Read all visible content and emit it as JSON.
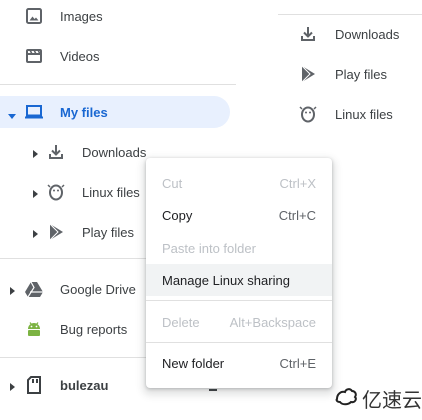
{
  "colors": {
    "accent": "#1967d2",
    "selected_bg": "#e8f0fe",
    "text": "#3c4043",
    "disabled_text": "#bdc1c6",
    "android_green": "#7cb342",
    "drive_grey": "#5f6368"
  },
  "sidebar": {
    "items": [
      {
        "label": "Images",
        "icon": "image-icon"
      },
      {
        "label": "Videos",
        "icon": "video-icon"
      },
      {
        "label": "My files",
        "icon": "laptop-icon",
        "selected": true
      },
      {
        "label": "Downloads",
        "icon": "download-icon"
      },
      {
        "label": "Linux files",
        "icon": "penguin-icon"
      },
      {
        "label": "Play files",
        "icon": "play-icon"
      },
      {
        "label": "Google Drive",
        "icon": "drive-icon"
      },
      {
        "label": "Bug reports",
        "icon": "android-icon"
      },
      {
        "label": "bulezau",
        "icon": "usb-drive-icon"
      }
    ]
  },
  "main": {
    "files": [
      {
        "label": "Downloads",
        "icon": "download-icon"
      },
      {
        "label": "Play files",
        "icon": "play-icon"
      },
      {
        "label": "Linux files",
        "icon": "penguin-icon"
      }
    ]
  },
  "context_menu": {
    "items": [
      {
        "label": "Cut",
        "shortcut": "Ctrl+X",
        "disabled": true
      },
      {
        "label": "Copy",
        "shortcut": "Ctrl+C",
        "disabled": false
      },
      {
        "label": "Paste into folder",
        "shortcut": "",
        "disabled": true
      },
      {
        "label": "Manage Linux sharing",
        "shortcut": "",
        "disabled": false,
        "hovered": true
      },
      {
        "label": "Delete",
        "shortcut": "Alt+Backspace",
        "disabled": true
      },
      {
        "label": "New folder",
        "shortcut": "Ctrl+E",
        "disabled": false
      }
    ]
  },
  "watermark": {
    "text": "亿速云"
  }
}
